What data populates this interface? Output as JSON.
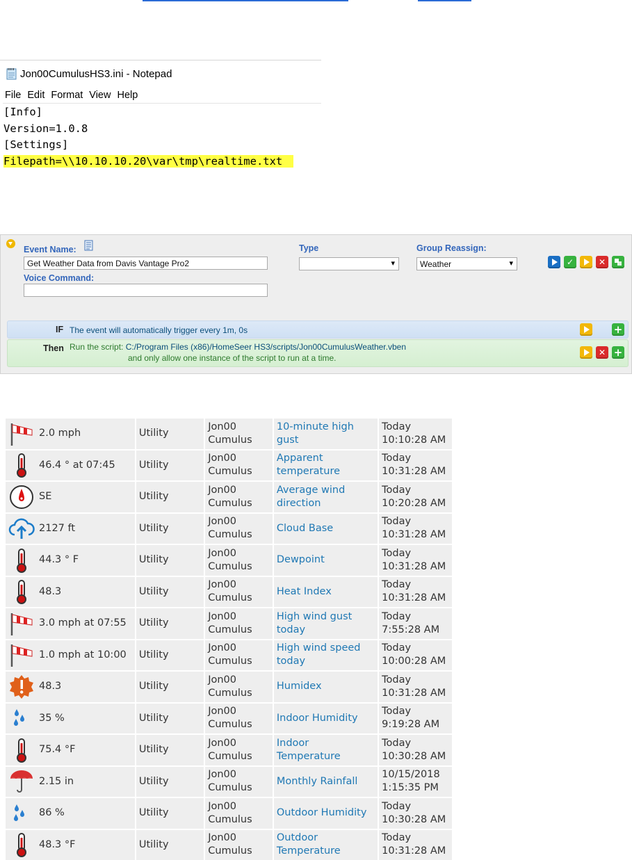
{
  "notepad": {
    "title": "Jon00CumulusHS3.ini - Notepad",
    "menu": [
      "File",
      "Edit",
      "Format",
      "View",
      "Help"
    ],
    "lines": [
      "[Info]",
      "Version=1.0.8",
      "[Settings]"
    ],
    "highlight_line": "Filepath=\\\\10.10.10.20\\var\\tmp\\realtime.txt"
  },
  "event": {
    "event_name_label": "Event Name:",
    "event_name_value": "Get Weather Data from Davis Vantage Pro2",
    "voice_command_label": "Voice Command:",
    "voice_command_value": "",
    "type_label": "Type",
    "type_value": "",
    "group_label": "Group Reassign:",
    "group_value": "Weather",
    "if_keyword": "IF",
    "if_text": "The event will automatically trigger every 1m, 0s",
    "then_keyword": "Then",
    "then_text": "Run the script:",
    "then_script": "C:/Program Files (x86)/HomeSeer HS3/scripts/Jon00CumulusWeather.vben",
    "then_text2": "and only allow one instance of the script to run at a time."
  },
  "devices": [
    {
      "icon": "windsock-icon",
      "value": "2.0 mph",
      "room": "Utility",
      "floor": "Jon00 Cumulus",
      "name": "10-minute high gust",
      "updated_day": "Today",
      "updated_time": "10:10:28 AM"
    },
    {
      "icon": "thermometer-icon",
      "value": "46.4 ° at 07:45",
      "room": "Utility",
      "floor": "Jon00 Cumulus",
      "name": "Apparent temperature",
      "updated_day": "Today",
      "updated_time": "10:31:28 AM"
    },
    {
      "icon": "compass-icon",
      "value": "SE",
      "room": "Utility",
      "floor": "Jon00 Cumulus",
      "name": "Average wind direction",
      "updated_day": "Today",
      "updated_time": "10:20:28 AM"
    },
    {
      "icon": "cloud-upload-icon",
      "value": "2127 ft",
      "room": "Utility",
      "floor": "Jon00 Cumulus",
      "name": "Cloud Base",
      "updated_day": "Today",
      "updated_time": "10:31:28 AM"
    },
    {
      "icon": "thermometer-icon",
      "value": "44.3 ° F",
      "room": "Utility",
      "floor": "Jon00 Cumulus",
      "name": "Dewpoint",
      "updated_day": "Today",
      "updated_time": "10:31:28 AM"
    },
    {
      "icon": "thermometer-icon",
      "value": "48.3",
      "room": "Utility",
      "floor": "Jon00 Cumulus",
      "name": "Heat Index",
      "updated_day": "Today",
      "updated_time": "10:31:28 AM"
    },
    {
      "icon": "windsock-icon",
      "value": "3.0 mph at 07:55",
      "room": "Utility",
      "floor": "Jon00 Cumulus",
      "name": "High wind gust today",
      "updated_day": "Today",
      "updated_time": "7:55:28 AM"
    },
    {
      "icon": "windsock-icon",
      "value": "1.0 mph at 10:00",
      "room": "Utility",
      "floor": "Jon00 Cumulus",
      "name": "High wind speed today",
      "updated_day": "Today",
      "updated_time": "10:00:28 AM"
    },
    {
      "icon": "alert-badge-icon",
      "value": "48.3",
      "room": "Utility",
      "floor": "Jon00 Cumulus",
      "name": "Humidex",
      "updated_day": "Today",
      "updated_time": "10:31:28 AM"
    },
    {
      "icon": "water-drops-icon",
      "value": "35 %",
      "room": "Utility",
      "floor": "Jon00 Cumulus",
      "name": "Indoor Humidity",
      "updated_day": "Today",
      "updated_time": "9:19:28 AM"
    },
    {
      "icon": "thermometer-icon",
      "value": "75.4 °F",
      "room": "Utility",
      "floor": "Jon00 Cumulus",
      "name": "Indoor Temperature",
      "updated_day": "Today",
      "updated_time": "10:30:28 AM"
    },
    {
      "icon": "umbrella-icon",
      "value": "2.15 in",
      "room": "Utility",
      "floor": "Jon00 Cumulus",
      "name": "Monthly Rainfall",
      "updated_day": "10/15/2018",
      "updated_time": "1:15:35 PM"
    },
    {
      "icon": "water-drops-icon",
      "value": "86 %",
      "room": "Utility",
      "floor": "Jon00 Cumulus",
      "name": "Outdoor Humidity",
      "updated_day": "Today",
      "updated_time": "10:30:28 AM"
    },
    {
      "icon": "thermometer-icon",
      "value": "48.3 °F",
      "room": "Utility",
      "floor": "Jon00 Cumulus",
      "name": "Outdoor Temperature",
      "updated_day": "Today",
      "updated_time": "10:31:28 AM"
    }
  ],
  "colors": {
    "link": "#1f78b4",
    "label_blue": "#3366bb",
    "highlight": "#ffff44"
  }
}
